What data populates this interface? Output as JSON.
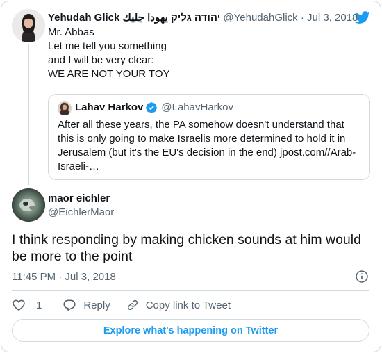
{
  "parent": {
    "name": "Yehudah Glick יהודה גליק يهودا جليك",
    "handle": "@YehudahGlick",
    "dot": "·",
    "date": "Jul 3, 2018",
    "lines": [
      "Mr. Abbas",
      "Let me tell you something",
      "and I will be very clear:",
      "WE ARE NOT YOUR TOY"
    ]
  },
  "quote": {
    "name": "Lahav Harkov",
    "handle": "@LahavHarkov",
    "text": "After all these years, the PA somehow doesn't understand that this is only going to make Israelis more determined to hold it in Jerusalem (but it's the EU's decision in the end) jpost.com//Arab-Israeli-…"
  },
  "main": {
    "name": "maor eichler",
    "handle": "@EichlerMaor",
    "text": "I think responding by making chicken sounds at him would be more to the point",
    "timestamp": "11:45 PM · Jul 3, 2018"
  },
  "actions": {
    "like_count": "1",
    "reply_label": "Reply",
    "copy_label": "Copy link to Tweet"
  },
  "explore_label": "Explore what's happening on Twitter",
  "colors": {
    "accent": "#1d9bf0",
    "secondary_text": "#536471",
    "border": "#cfd9de"
  },
  "icons": [
    "twitter-bird-icon",
    "verified-badge-icon",
    "info-icon",
    "heart-icon",
    "reply-icon",
    "link-icon"
  ]
}
